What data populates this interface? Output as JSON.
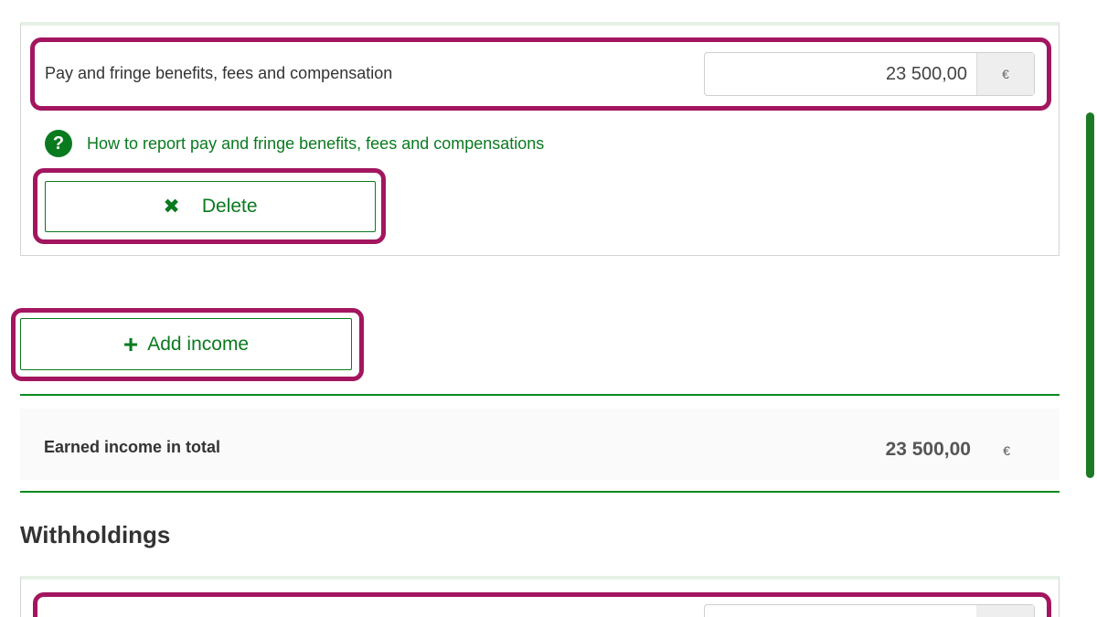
{
  "income_item": {
    "label": "Pay and fringe benefits, fees and compensation",
    "amount": "23 500,00",
    "currency": "€",
    "help_link": "How to report pay and fringe benefits, fees and compensations",
    "help_icon": "?",
    "delete_label": "Delete",
    "delete_icon": "✖"
  },
  "add_income": {
    "label": "Add income",
    "icon": "+"
  },
  "total": {
    "label": "Earned income in total",
    "amount": "23 500,00",
    "currency": "€"
  },
  "withholdings": {
    "title": "Withholdings"
  },
  "colors": {
    "accent_green": "#0a7a1f",
    "highlight": "#a3165f"
  }
}
